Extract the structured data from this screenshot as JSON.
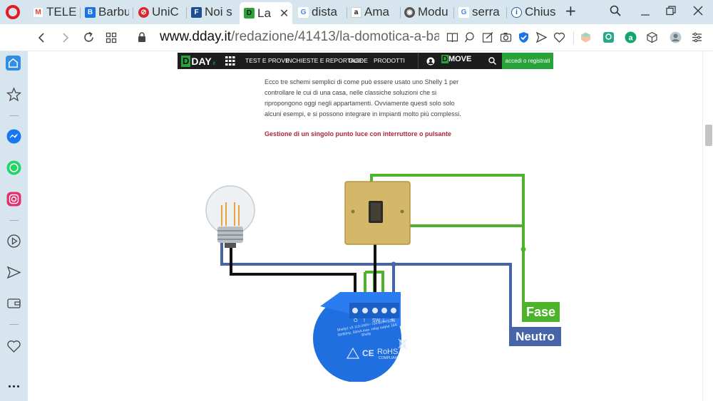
{
  "browser": {
    "tabs": [
      {
        "label": "TELES",
        "fav_color": "#e94235",
        "fav_text": "M"
      },
      {
        "label": "Barbu",
        "fav_color": "#1a73e8",
        "fav_text": "B"
      },
      {
        "label": "UniC",
        "fav_color": "#d9262f",
        "fav_text": "⊘"
      },
      {
        "label": "Noi s",
        "fav_color": "#2b6cb0",
        "fav_text": "F"
      },
      {
        "label": "La",
        "fav_color": "#2aa23a",
        "fav_text": "D",
        "active": true
      },
      {
        "label": "dista",
        "fav_color": "#ffffff",
        "fav_text": "G"
      },
      {
        "label": "Ama",
        "fav_color": "#ffffff",
        "fav_text": "a"
      },
      {
        "label": "Modu",
        "fav_color": "#555555",
        "fav_text": "◉"
      },
      {
        "label": "serra",
        "fav_color": "#ffffff",
        "fav_text": "G"
      },
      {
        "label": "Chius",
        "fav_color": "#ffffff",
        "fav_text": "ⓘ"
      }
    ],
    "new_tab_symbol": "+",
    "url_domain": "www.dday.it",
    "url_path": "/redazione/41413/la-domotica-a-ba"
  },
  "site": {
    "logo_d": "D",
    "logo_rest": "DAY",
    "logo_suffix": ".it",
    "nav_links": [
      "TEST E PROVE",
      "INCHIESTE E REPORTAGE",
      "GUIDE",
      "PRODOTTI"
    ],
    "dmove_d": "D",
    "dmove_rest": "MOVE",
    "access_label": "accedi o registrati"
  },
  "article": {
    "paragraph": "Ecco tre schemi semplici di come può essere usato uno Shelly 1 per controllare le cui di una casa, nelle classiche soluzioni che si ripropongono oggi negli appartamenti. Ovviamente questi solo solo alcuni esempi, e si possono integrare in impianti molto più complessi.",
    "subheading": "Gestione di un singolo punto luce con interruttore o pulsante"
  },
  "diagram": {
    "fase_label": "Fase",
    "neutro_label": "Neutro",
    "terminals": [
      "O",
      "I",
      "SW",
      "L",
      "N"
    ],
    "device_line1": "Shelly1 v3 110-240V~ /24-60V=/12V",
    "device_line2": "50/60Hz, 50mA max. relay output 16A",
    "device_brand": "Shelly",
    "rohs": "RoHS",
    "compliant": "COMPLIANT",
    "colors": {
      "green": "#4db32a",
      "blue": "#4565a8",
      "black": "#111111",
      "device": "#1f6fe0"
    }
  }
}
